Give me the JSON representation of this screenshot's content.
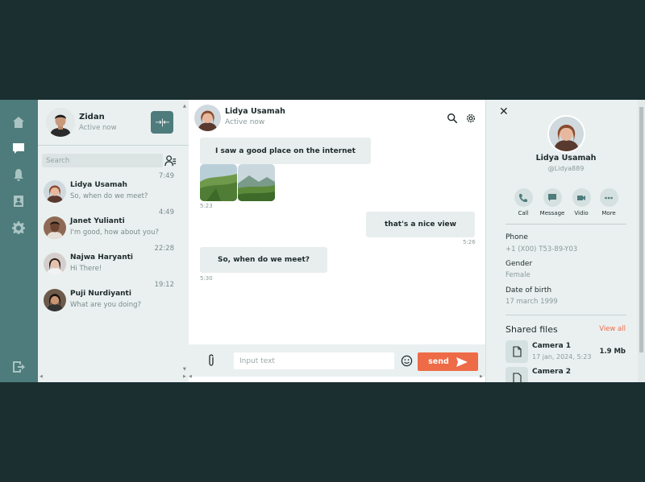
{
  "nav": {
    "items": [
      {
        "icon": "home-icon"
      },
      {
        "icon": "chat-icon",
        "active": true
      },
      {
        "icon": "bell-icon"
      },
      {
        "icon": "contacts-icon"
      },
      {
        "icon": "gear-icon"
      }
    ],
    "logout_icon": "logout-icon"
  },
  "me": {
    "name": "Zidan",
    "status": "Active now"
  },
  "search": {
    "placeholder": "Search"
  },
  "contacts": [
    {
      "name": "Lidya Usamah",
      "message": "So, when do we meet?",
      "time": "7:49"
    },
    {
      "name": "Janet Yulianti",
      "message": "I'm good, how about you?",
      "time": "4:49"
    },
    {
      "name": "Najwa Haryanti",
      "message": "Hi There!",
      "time": "22:28"
    },
    {
      "name": "Puji Nurdiyanti",
      "message": "What are you doing?",
      "time": "19:12"
    }
  ],
  "chat": {
    "name": "Lidya Usamah",
    "status": "Active now",
    "messages": [
      {
        "text": "I saw a good place on the internet"
      },
      {
        "time": "5:23"
      },
      {
        "text": "that's a nice view",
        "time": "5:26"
      },
      {
        "text": "So, when do we meet?",
        "time": "5:30"
      }
    ],
    "input_placeholder": "Input text",
    "send_label": "send"
  },
  "profile": {
    "name": "Lidya Usamah",
    "handle": "@Lidya889",
    "actions": [
      "Call",
      "Message",
      "Vidio",
      "More"
    ],
    "phone_label": "Phone",
    "phone": "+1 (X00) T53-89-Y03",
    "gender_label": "Gender",
    "gender": "Female",
    "dob_label": "Date of birth",
    "dob": "17 march 1999",
    "files_title": "Shared files",
    "view_all": "View all",
    "files": [
      {
        "name": "Camera 1",
        "date": "17 jan, 2024, 5:23",
        "size": "1.9 Mb"
      },
      {
        "name": "Camera 2",
        "date": "",
        "size": ""
      }
    ]
  },
  "colors": {
    "accent": "#ee6b47",
    "rail": "#4e7b7b",
    "panel": "#eaf0f0",
    "background": "#1b2f31"
  }
}
